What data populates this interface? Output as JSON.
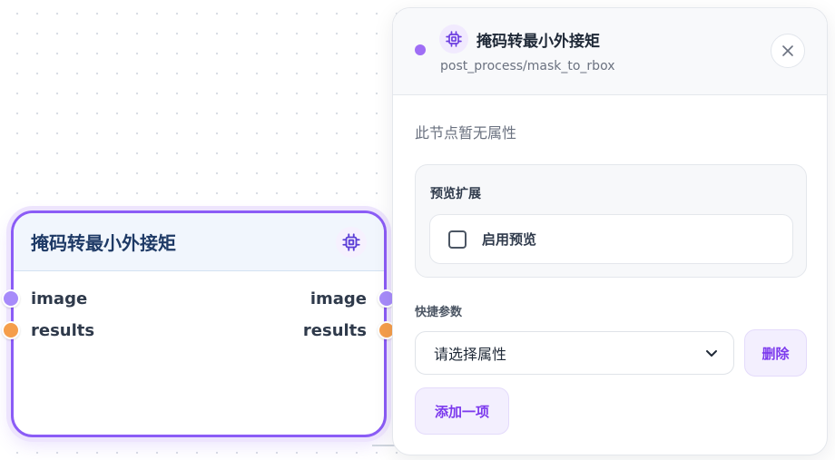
{
  "colors": {
    "accent": "#8b5cf6",
    "port_image": "#a78bfa",
    "port_results": "#f59e4b",
    "node_title": "#1e3a66"
  },
  "node": {
    "title": "掩码转最小外接矩",
    "icon": "chip-icon",
    "inputs": [
      {
        "label": "image",
        "color": "purple"
      },
      {
        "label": "results",
        "color": "orange"
      }
    ],
    "outputs": [
      {
        "label": "image",
        "color": "purple"
      },
      {
        "label": "results",
        "color": "orange"
      }
    ]
  },
  "panel": {
    "title": "掩码转最小外接矩",
    "subtitle": "post_process/mask_to_rbox",
    "icon": "chip-icon",
    "close_icon": "close-icon",
    "empty_properties": "此节点暂无属性",
    "preview": {
      "title": "预览扩展",
      "enable_label": "启用预览",
      "enabled": false
    },
    "quick_params": {
      "label": "快捷参数",
      "select_placeholder": "请选择属性",
      "delete_label": "删除",
      "add_label": "添加一项"
    }
  }
}
